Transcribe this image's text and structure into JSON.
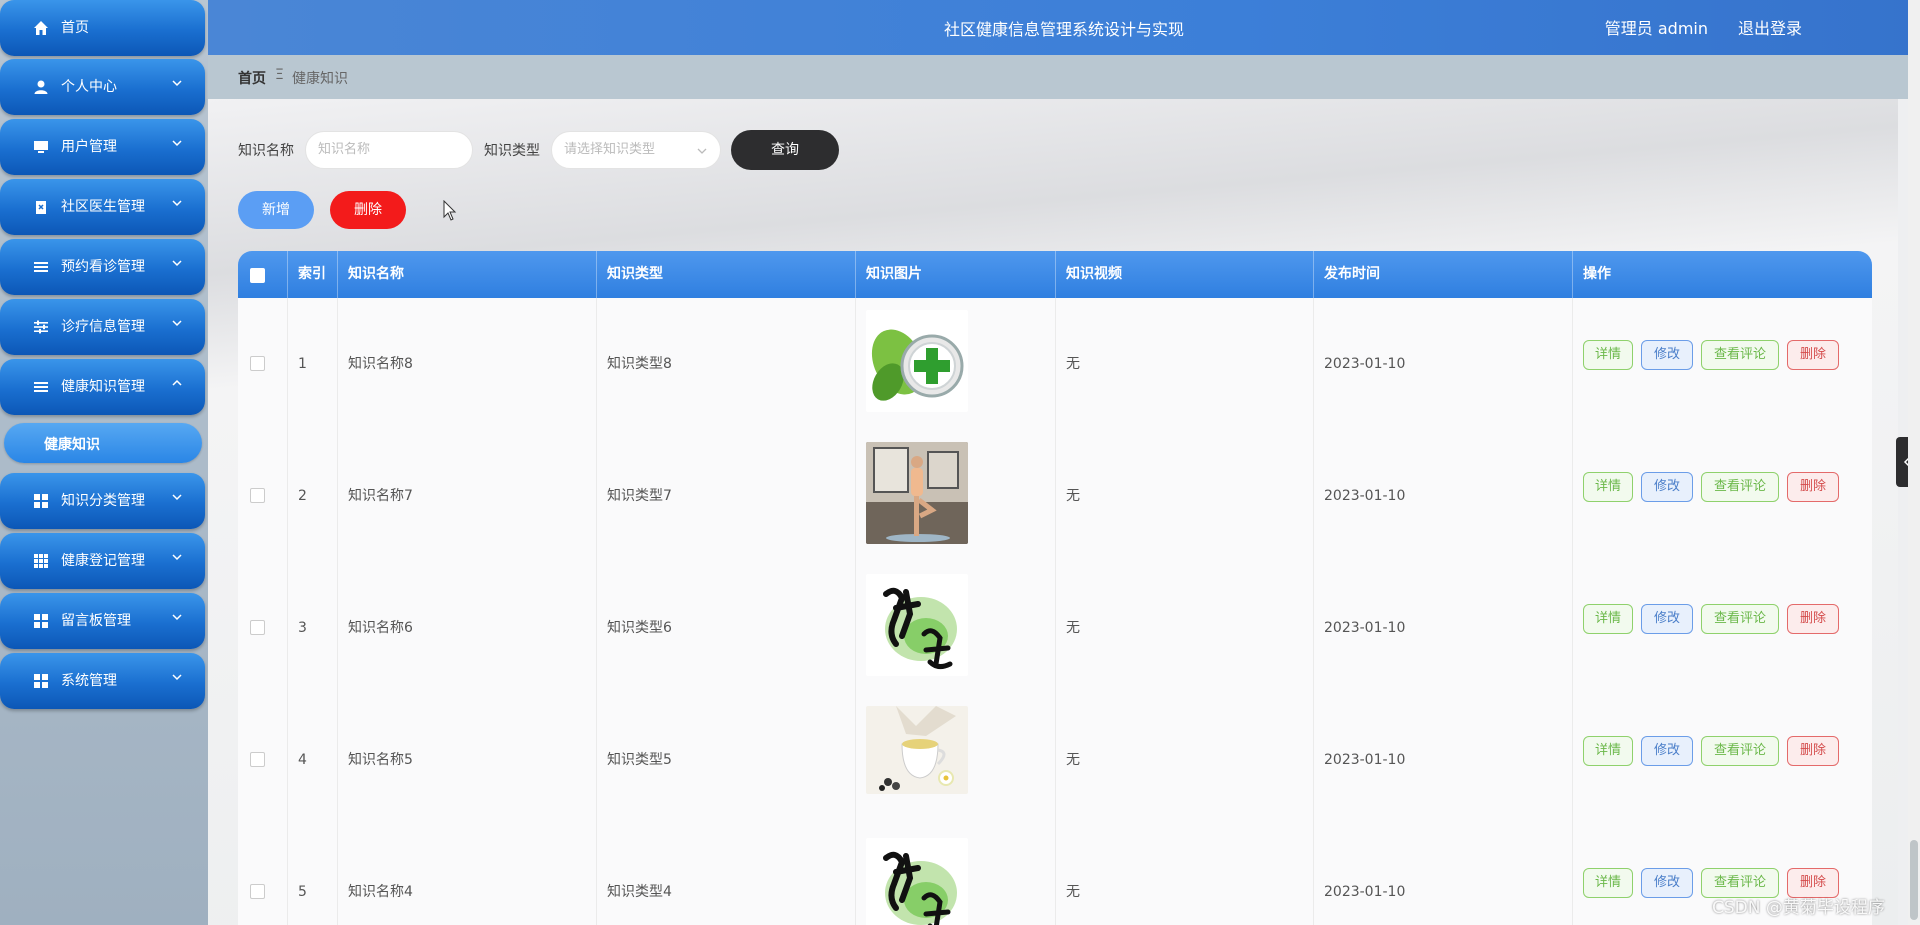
{
  "app": {
    "title": "社区健康信息管理系统设计与实现",
    "user_label": "管理员 admin",
    "logout_label": "退出登录"
  },
  "sidebar": {
    "items": [
      {
        "label": "首页",
        "icon": "home-icon"
      },
      {
        "label": "个人中心",
        "icon": "user-icon"
      },
      {
        "label": "用户管理",
        "icon": "monitor-icon"
      },
      {
        "label": "社区医生管理",
        "icon": "clipboard-icon"
      },
      {
        "label": "预约看诊管理",
        "icon": "list-icon"
      },
      {
        "label": "诊疗信息管理",
        "icon": "sliders-icon"
      },
      {
        "label": "健康知识管理",
        "icon": "list-icon"
      },
      {
        "label": "知识分类管理",
        "icon": "grid-icon"
      },
      {
        "label": "健康登记管理",
        "icon": "grid-icon"
      },
      {
        "label": "留言板管理",
        "icon": "grid-icon"
      },
      {
        "label": "系统管理",
        "icon": "grid-icon"
      }
    ],
    "submenu_active": "健康知识"
  },
  "breadcrumb": {
    "home": "首页",
    "separator": "Ξ",
    "current": "健康知识"
  },
  "search": {
    "name_label": "知识名称",
    "name_placeholder": "知识名称",
    "type_label": "知识类型",
    "type_placeholder": "请选择知识类型",
    "query_label": "查询"
  },
  "actions": {
    "add_label": "新增",
    "delete_label": "删除"
  },
  "table": {
    "headers": [
      "索引",
      "知识名称",
      "知识类型",
      "知识图片",
      "知识视频",
      "发布时间",
      "操作"
    ],
    "rows": [
      {
        "index": "1",
        "name": "知识名称8",
        "type": "知识类型8",
        "image": "health-cross-leaf",
        "video": "无",
        "date": "2023-01-10"
      },
      {
        "index": "2",
        "name": "知识名称7",
        "type": "知识类型7",
        "image": "yoga-pose",
        "video": "无",
        "date": "2023-01-10"
      },
      {
        "index": "3",
        "name": "知识名称6",
        "type": "知识类型6",
        "image": "health-calligraphy",
        "video": "无",
        "date": "2023-01-10"
      },
      {
        "index": "4",
        "name": "知识名称5",
        "type": "知识类型5",
        "image": "tea-cup",
        "video": "无",
        "date": "2023-01-10"
      },
      {
        "index": "5",
        "name": "知识名称4",
        "type": "知识类型4",
        "image": "health-calligraphy",
        "video": "无",
        "date": "2023-01-10"
      }
    ],
    "ops": {
      "detail": "详情",
      "edit": "修改",
      "comments": "查看评论",
      "delete": "删除"
    }
  },
  "watermark": "CSDN @黄菊毕设程序",
  "colors": {
    "header": "#3c7fd8",
    "menu": "#1a6fd0",
    "query_button": "#2d2d2f",
    "add_button": "#5b9ef4",
    "delete_button": "#f31b1b"
  }
}
